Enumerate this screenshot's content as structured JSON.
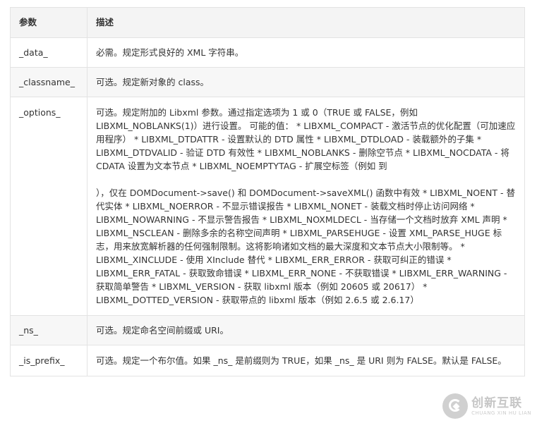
{
  "table": {
    "headers": [
      "参数",
      "描述"
    ],
    "rows": [
      {
        "param": "_data_",
        "desc": [
          "必需。规定形式良好的 XML 字符串。"
        ]
      },
      {
        "param": "_classname_",
        "desc": [
          "可选。规定新对象的 class。"
        ]
      },
      {
        "param": "_options_",
        "desc": [
          "可选。规定附加的 Libxml 参数。通过指定选项为 1 或 0（TRUE 或 FALSE，例如 LIBXML_NOBLANKS(1)）进行设置。 可能的值： * LIBXML_COMPACT - 激活节点的优化配置（可加速应用程序） * LIBXML_DTDATTR - 设置默认的 DTD 属性 * LIBXML_DTDLOAD - 装载额外的子集 * LIBXML_DTDVALID - 验证 DTD 有效性 * LIBXML_NOBLANKS - 删除空节点 * LIBXML_NOCDATA - 将 CDATA 设置为文本节点 * LIBXML_NOEMPTYTAG - 扩展空标签（例如 到",
          "），仅在 DOMDocument->save() 和 DOMDocument->saveXML() 函数中有效 * LIBXML_NOENT - 替代实体 * LIBXML_NOERROR - 不显示错误报告 * LIBXML_NONET - 装载文档时停止访问网络 * LIBXML_NOWARNING - 不显示警告报告 * LIBXML_NOXMLDECL - 当存储一个文档时放弃 XML 声明 * LIBXML_NSCLEAN - 删除多余的名称空间声明 * LIBXML_PARSEHUGE - 设置 XML_PARSE_HUGE 标志，用来放宽解析器的任何强制限制。这将影响诸如文档的最大深度和文本节点大小限制等。 * LIBXML_XINCLUDE - 使用 XInclude 替代 * LIBXML_ERR_ERROR - 获取可纠正的错误 * LIBXML_ERR_FATAL - 获取致命错误 * LIBXML_ERR_NONE - 不获取错误 * LIBXML_ERR_WARNING - 获取简单警告 * LIBXML_VERSION - 获取 libxml 版本（例如 20605 或 20617） * LIBXML_DOTTED_VERSION - 获取带点的 libxml 版本（例如 2.6.5 或 2.6.17）"
        ]
      },
      {
        "param": "_ns_",
        "desc": [
          "可选。规定命名空间前缀或 URI。"
        ]
      },
      {
        "param": "_is_prefix_",
        "desc": [
          "可选。规定一个布尔值。如果 _ns_ 是前缀则为 TRUE，如果 _ns_ 是 URI 则为 FALSE。默认是 FALSE。"
        ]
      }
    ]
  },
  "watermark": {
    "brand_cn": "创新互联",
    "brand_en": "CHUANG XIN HU LIAN",
    "icon": "brand-logo-icon"
  }
}
